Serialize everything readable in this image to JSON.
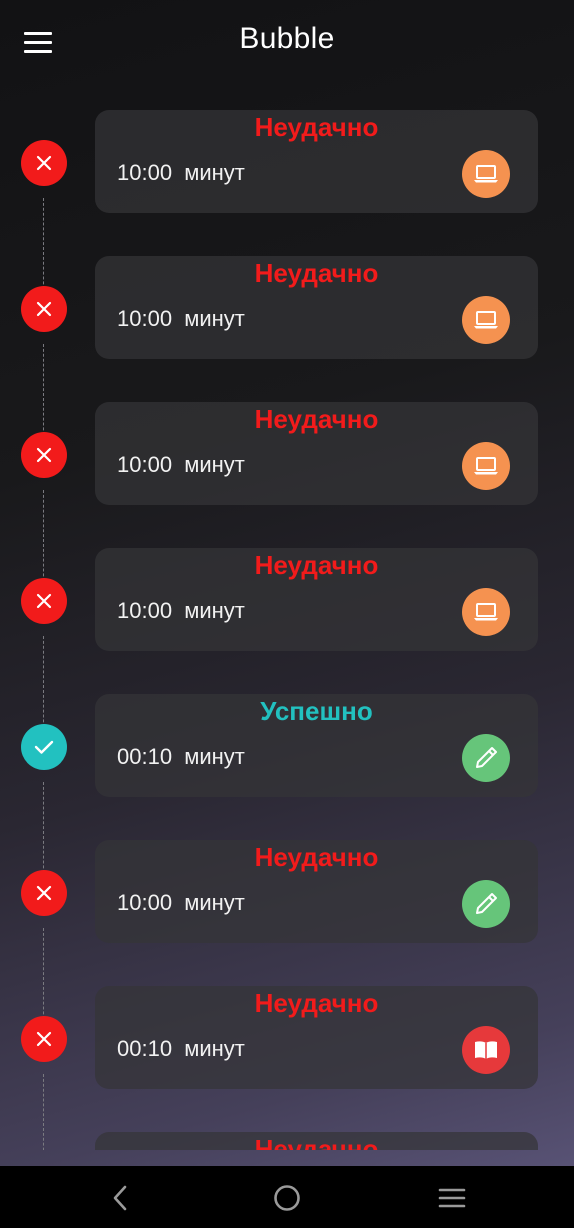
{
  "app": {
    "title": "Bubble"
  },
  "colors": {
    "failed": "#f21b1b",
    "success": "#22c1c0",
    "laptop": "#f59250",
    "pen": "#66c57a",
    "book": "#e6393b"
  },
  "entries": [
    {
      "status": "Неудачно",
      "state": "failed",
      "time": "10:00",
      "unit": "минут",
      "icon": "laptop-icon"
    },
    {
      "status": "Неудачно",
      "state": "failed",
      "time": "10:00",
      "unit": "минут",
      "icon": "laptop-icon"
    },
    {
      "status": "Неудачно",
      "state": "failed",
      "time": "10:00",
      "unit": "минут",
      "icon": "laptop-icon"
    },
    {
      "status": "Неудачно",
      "state": "failed",
      "time": "10:00",
      "unit": "минут",
      "icon": "laptop-icon"
    },
    {
      "status": "Успешно",
      "state": "success",
      "time": "00:10",
      "unit": "минут",
      "icon": "pen-icon"
    },
    {
      "status": "Неудачно",
      "state": "failed",
      "time": "10:00",
      "unit": "минут",
      "icon": "pen-icon"
    },
    {
      "status": "Неудачно",
      "state": "failed",
      "time": "00:10",
      "unit": "минут",
      "icon": "book-icon"
    },
    {
      "status": "Неудачно",
      "state": "failed",
      "time": "",
      "unit": "",
      "icon": ""
    }
  ],
  "nav": {
    "back": "back-icon",
    "home": "home-icon",
    "recents": "recents-icon"
  }
}
